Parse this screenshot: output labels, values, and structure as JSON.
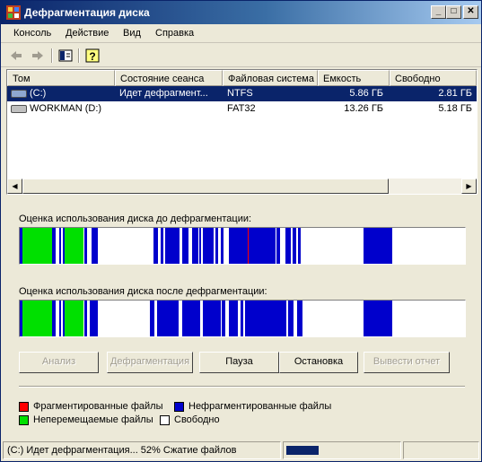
{
  "window": {
    "title": "Дефрагментация диска",
    "controls": {
      "minimize": "_",
      "maximize": "□",
      "close": "✕"
    }
  },
  "menu": [
    "Консоль",
    "Действие",
    "Вид",
    "Справка"
  ],
  "toolbar": {
    "icons": [
      "back-arrow-icon",
      "forward-arrow-icon",
      "show-hide-tree-icon",
      "help-icon"
    ]
  },
  "volumes": {
    "columns": [
      "Том",
      "Состояние сеанса",
      "Файловая система",
      "Емкость",
      "Свободно"
    ],
    "rows": [
      {
        "name": "(C:)",
        "status": "Идет дефрагмент...",
        "fs": "NTFS",
        "capacity": "5.86 ГБ",
        "free": "2.81 ГБ",
        "selected": true
      },
      {
        "name": "WORKMAN (D:)",
        "status": "",
        "fs": "FAT32",
        "capacity": "13.26 ГБ",
        "free": "5.18 ГБ",
        "selected": false
      }
    ]
  },
  "analysis": {
    "before_label": "Оценка использования диска до дефрагментации:",
    "after_label": "Оценка использования диска после дефрагментации:"
  },
  "buttons": {
    "analyze": "Анализ",
    "defragment": "Дефрагментация",
    "pause": "Пауза",
    "stop": "Остановка",
    "report": "Вывести отчет"
  },
  "legend": {
    "fragmented": "Фрагментированные файлы",
    "contiguous": "Нефрагментированные файлы",
    "unmovable": "Неперемещаемые файлы",
    "free": "Свободно"
  },
  "colors": {
    "fragmented": "#ff0000",
    "contiguous": "#0000cc",
    "unmovable": "#00e000",
    "free": "#ffffff",
    "selection": "#0a246a"
  },
  "status": {
    "text": "(C:) Идет дефрагментация... 52%  Сжатие файлов",
    "progress_percent": 52
  }
}
